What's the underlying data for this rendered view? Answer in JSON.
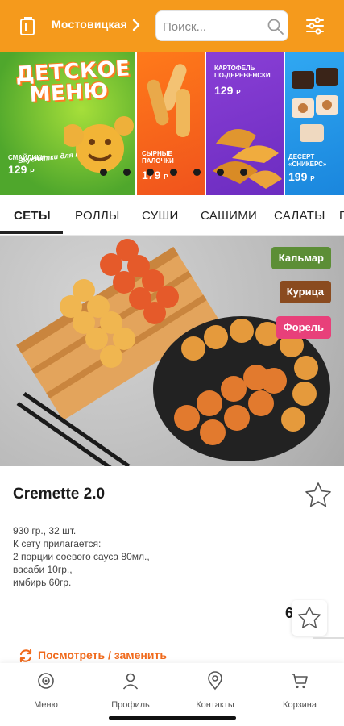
{
  "header": {
    "location": "Мостовицкая",
    "search_placeholder": "Поиск...",
    "colors": {
      "header_bg": "#f59a1c"
    },
    "icons": [
      "store-icon",
      "chevron-right-icon",
      "search-icon",
      "filter-icon"
    ]
  },
  "banners": [
    {
      "title_lines": [
        "ДЕТСКОЕ",
        "МЕНЮ"
      ],
      "subtitle": "Вкуснятки для малышей!",
      "name_lines": [
        "СМАЙЛИКИ"
      ],
      "price": "129",
      "currency": "Р"
    },
    {
      "name_lines": [
        "СЫРНЫЕ",
        "ПАЛОЧКИ"
      ],
      "price": "179",
      "currency": "Р"
    },
    {
      "name_lines": [
        "КАРТОФЕЛЬ",
        "ПО-ДЕРЕВЕНСКИ"
      ],
      "price": "129",
      "currency": "Р"
    },
    {
      "name_lines": [
        "ДЕСЕРТ",
        "«СНИКЕРС»"
      ],
      "price": "199",
      "currency": "Р"
    }
  ],
  "carousel": {
    "slides": 7,
    "active_index": 0
  },
  "tabs": [
    {
      "label": "СЕТЫ",
      "active": true
    },
    {
      "label": "РОЛЛЫ",
      "active": false
    },
    {
      "label": "СУШИ",
      "active": false
    },
    {
      "label": "САШИМИ",
      "active": false
    },
    {
      "label": "САЛАТЫ",
      "active": false
    },
    {
      "label": "П",
      "active": false
    }
  ],
  "product": {
    "tags": [
      {
        "label": "Кальмар",
        "color": "#5c8e36"
      },
      {
        "label": "Курица",
        "color": "#8a4b1f"
      },
      {
        "label": "Форель",
        "color": "#e8407a"
      }
    ],
    "title": "Cremette 2.0",
    "desc_lines": [
      "930 гр., 32 шт.",
      "К сету прилагается:",
      "2 порции соевого сауса 80мл.,",
      "васаби 10гр.,",
      "имбирь 60гр."
    ],
    "price_partial": "6",
    "swap_label": "Посмотреть / заменить",
    "accent": "#f06a1c"
  },
  "bottom_nav": [
    {
      "label": "Меню",
      "icon": "menu-sushi-icon"
    },
    {
      "label": "Профиль",
      "icon": "profile-icon"
    },
    {
      "label": "Контакты",
      "icon": "location-pin-icon"
    },
    {
      "label": "Корзина",
      "icon": "cart-icon"
    }
  ]
}
